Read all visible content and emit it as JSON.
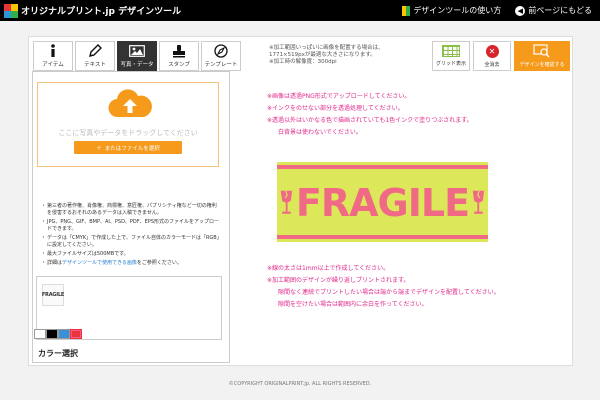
{
  "header": {
    "logo_text": "オリジナルプリント.jp デザインツール",
    "guide_label": "デザインツールの使い方",
    "back_label": "前ページにもどる"
  },
  "tabs": [
    {
      "label": "アイテム",
      "icon": "info-icon",
      "active": false
    },
    {
      "label": "テキスト",
      "icon": "pen-icon",
      "active": false
    },
    {
      "label": "写真・データ",
      "icon": "image-icon",
      "active": true
    },
    {
      "label": "スタンプ",
      "icon": "stamp-icon",
      "active": false
    },
    {
      "label": "テンプレート",
      "icon": "template-icon",
      "active": false
    }
  ],
  "upload": {
    "hint": "ここに写真やデータをドラッグしてください",
    "button_label": "またはファイルを選択"
  },
  "notes": [
    "第三者の著作権、肖像権、商標権、意匠権、パブリシティ権など一切の権利を侵害するおそれのあるデータは入稿できません。",
    "JPG、PNG、GIF、BMP、AI、PSD、PDF、EPS形式のファイルをアップロードできます。",
    "データは「CMYK」で作成した上で、ファイル自体のカラーモードは「RGB」に設定してください。",
    "最大ファイルサイズは500MBです。"
  ],
  "notes_link": {
    "prefix": "詳細は",
    "link": "デザインツールで使用できる画像",
    "suffix": "をご参照ください。"
  },
  "thumbnail_text": "FRAGILE",
  "color_title": "カラー選択",
  "swatches": [
    "#ffffff",
    "#000000",
    "#3a8fd6",
    "#e8343a"
  ],
  "info_lines": [
    "※加工範囲いっぱいに画像を配置する場合は、",
    "1771×519pxが最適な大きさになります。",
    "※加工時の解像度：300dpi"
  ],
  "tools": {
    "grid_label": "グリッド表示",
    "delete_label": "全消去",
    "confirm_label": "デザインを確認する"
  },
  "warnings_top": [
    "※画像は透過PNG形式でアップロードしてください。",
    "※インクをのせない部分を透過処理してください。",
    "※透過以外はいかなる色で描画されていても1色インクで塗りつぶされます。",
    "白背景は使わないでください。"
  ],
  "design_text": "FRAGILE",
  "warnings_bottom": [
    "※線の太さは1mm以上で作成してください。",
    "※加工範囲のデザインが繰り返しプリントされます。",
    "隙間なく連続でプリントしたい場合は端から端までデザインを配置してください。",
    "隙間を空けたい場合は範囲内に余白を作ってください。"
  ],
  "footer": "©COPYRIGHT ORIGINALPRINT.jp. ALL RIGHTS RESERVED.",
  "colors": {
    "accent_orange": "#f59a1b",
    "warning_pink": "#e0288a",
    "design_yellow": "#dce75a",
    "design_pink": "#f06a86"
  }
}
